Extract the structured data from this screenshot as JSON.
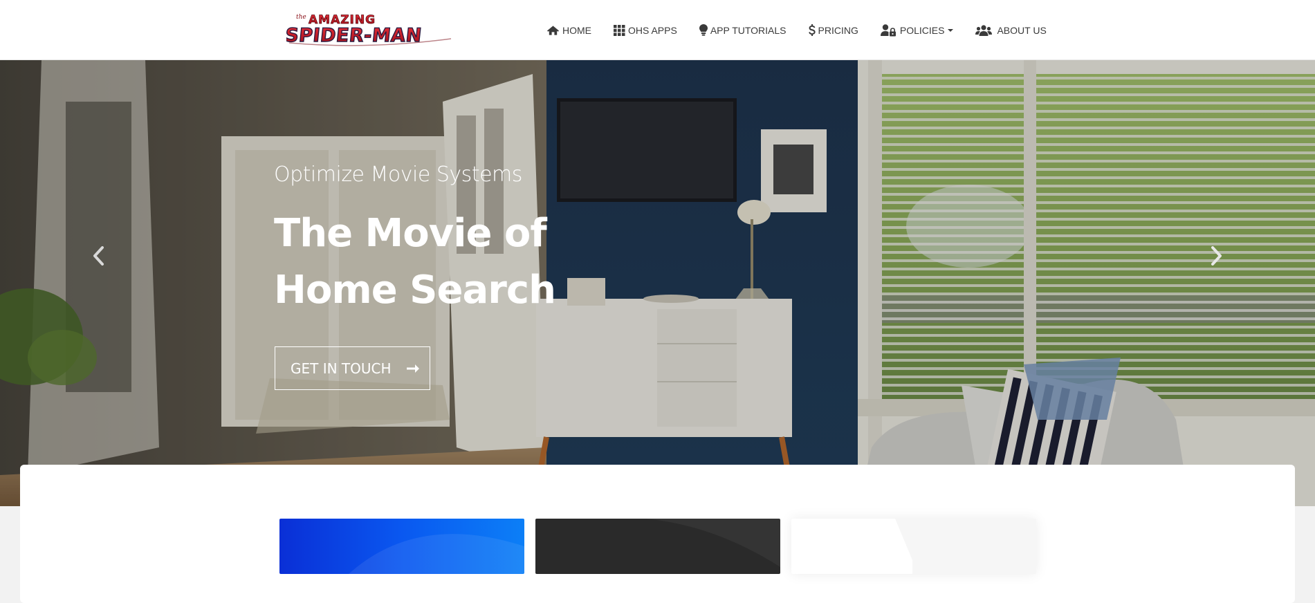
{
  "brand": {
    "logo_line1": "the AMAZING",
    "logo_line2": "SPIDER-MAN"
  },
  "nav": {
    "items": [
      {
        "label": "HOME",
        "icon": "home-icon"
      },
      {
        "label": "OHS APPS",
        "icon": "grid-icon"
      },
      {
        "label": "APP TUTORIALS",
        "icon": "lightbulb-icon"
      },
      {
        "label": "PRICING",
        "icon": "dollar-icon"
      },
      {
        "label": "POLICIES",
        "icon": "user-lock-icon",
        "dropdown": true
      },
      {
        "label": "ABOUT US",
        "icon": "users-icon"
      }
    ]
  },
  "hero": {
    "subtitle": "Optimize Movie Systems",
    "title": "The Movie of Home Search",
    "cta_label": "GET IN TOUCH",
    "cta_icon": "arrow-right-icon",
    "prev_icon": "chevron-left-icon",
    "next_icon": "chevron-right-icon"
  },
  "features": {
    "cards": [
      {
        "theme": "blue",
        "color": "#0a58f0"
      },
      {
        "theme": "dark",
        "color": "#2a2a2a"
      },
      {
        "theme": "light",
        "color": "#f6f6f6"
      }
    ]
  },
  "colors": {
    "nav_text": "#3a3a3a",
    "hero_text": "#ffffff",
    "logo_red": "#c8102e",
    "logo_blue": "#1c3f94"
  }
}
